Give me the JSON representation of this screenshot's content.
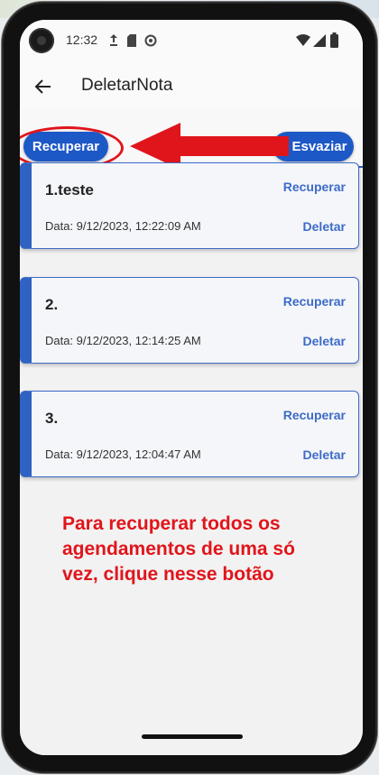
{
  "status_bar": {
    "time": "12:32"
  },
  "app_bar": {
    "title": "DeletarNota"
  },
  "toolbar": {
    "recover_all_label": "Recuperar",
    "empty_label": "Esvaziar"
  },
  "notes": [
    {
      "title": "1.teste",
      "date": "Data: 9/12/2023, 12:22:09 AM",
      "recover_label": "Recuperar",
      "delete_label": "Deletar"
    },
    {
      "title": "2.",
      "date": "Data: 9/12/2023, 12:14:25 AM",
      "recover_label": "Recuperar",
      "delete_label": "Deletar"
    },
    {
      "title": "3.",
      "date": "Data: 9/12/2023, 12:04:47 AM",
      "recover_label": "Recuperar",
      "delete_label": "Deletar"
    }
  ],
  "annotation": {
    "text": "Para recuperar todos os agendamentos de uma só vez, clique nesse botão"
  },
  "colors": {
    "primary": "#1d58c7",
    "accent_text": "#3d6bc7",
    "annotation": "#e0151b"
  }
}
